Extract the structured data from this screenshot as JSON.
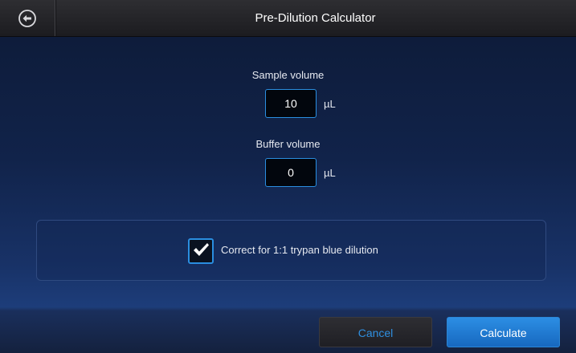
{
  "header": {
    "title": "Pre-Dilution Calculator",
    "back_icon": "circle-arrow-left-icon"
  },
  "form": {
    "sample_volume": {
      "label": "Sample volume",
      "value": "10",
      "unit": "µL"
    },
    "buffer_volume": {
      "label": "Buffer volume",
      "value": "0",
      "unit": "µL"
    },
    "trypan_correction": {
      "label": "Correct for 1:1 trypan blue dilution",
      "checked": true
    }
  },
  "footer": {
    "cancel_label": "Cancel",
    "calculate_label": "Calculate"
  },
  "colors": {
    "accent": "#2a8ee0",
    "primary_button": "#1f7ad2",
    "background_top": "#0d1a36",
    "background_bottom": "#1d3d7a"
  }
}
